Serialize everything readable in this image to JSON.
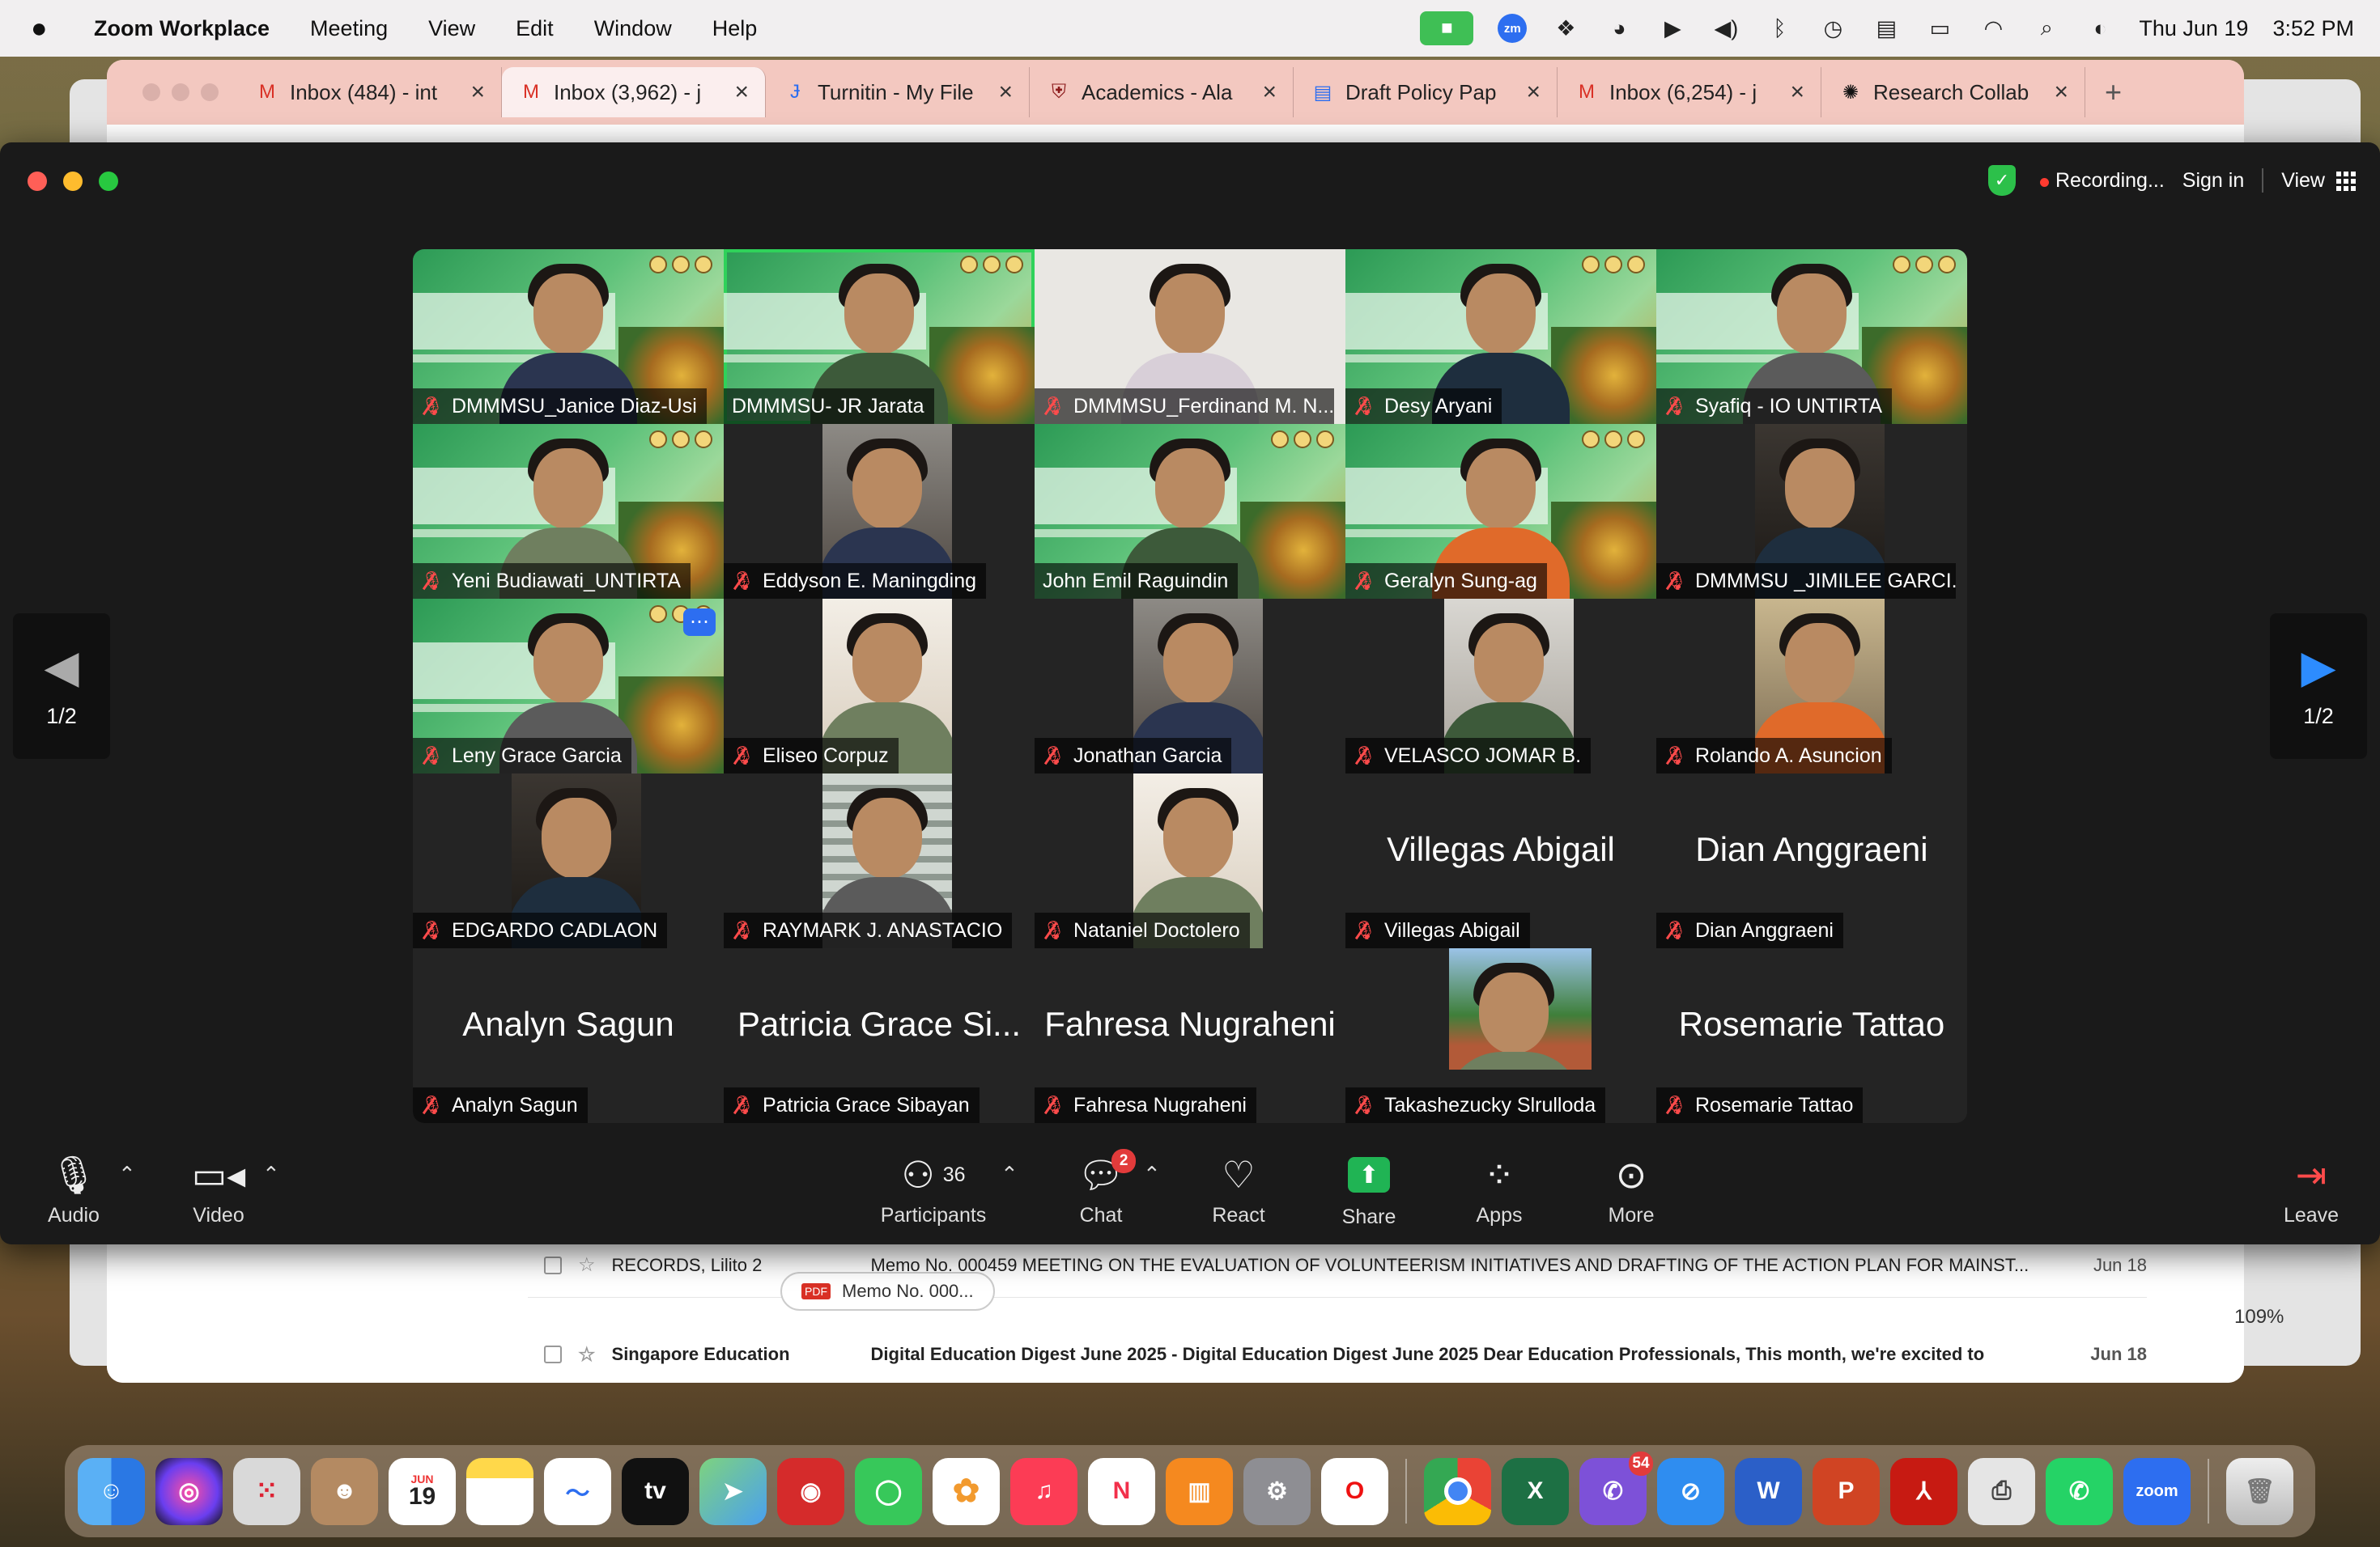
{
  "menubar": {
    "app_name": "Zoom Workplace",
    "menus": [
      "Meeting",
      "View",
      "Edit",
      "Window",
      "Help"
    ],
    "date": "Thu Jun 19",
    "time": "3:52 PM",
    "status_icons": [
      "zoom-video-icon",
      "zoom-badge-icon",
      "dropbox-icon",
      "creative-cloud-icon",
      "play-icon",
      "volume-icon",
      "bluetooth-icon",
      "time-machine-icon",
      "keyboard-icon",
      "battery-icon",
      "wifi-icon",
      "spotlight-icon",
      "control-center-icon"
    ]
  },
  "browser": {
    "tabs": [
      {
        "label": "Inbox (484) - int",
        "icon": "gmail-icon"
      },
      {
        "label": "Inbox (3,962) - j",
        "icon": "gmail-icon",
        "active": true
      },
      {
        "label": "Turnitin - My File",
        "icon": "turnitin-icon"
      },
      {
        "label": "Academics - Ala",
        "icon": "university-icon"
      },
      {
        "label": "Draft Policy Pap",
        "icon": "google-docs-icon"
      },
      {
        "label": "Inbox (6,254) - j",
        "icon": "gmail-icon"
      },
      {
        "label": "Research Collab",
        "icon": "openai-icon"
      }
    ],
    "new_tab": "+",
    "mail_rows": [
      {
        "sender": "RECORDS, Lilito 2",
        "subject": "Memo No. 000459 MEETING ON THE EVALUATION OF VOLUNTEERISM INITIATIVES AND DRAFTING OF THE ACTION PLAN FOR MAINST...",
        "date": "Jun 18"
      },
      {
        "sender": "Singapore Education",
        "subject": "Digital Education Digest June 2025 - Digital Education Digest June 2025 Dear Education Professionals, This month, we're excited to",
        "date": "Jun 18"
      }
    ],
    "attachment": "Memo No. 000...",
    "zoom_level": "109%"
  },
  "zoom": {
    "recording": "Recording...",
    "sign_in": "Sign in",
    "view": "View",
    "page_indicator": "1/2",
    "participants": [
      {
        "name": "DMMMSU_Janice Diaz-Usi",
        "video": "slide",
        "muted": true
      },
      {
        "name": "DMMMSU- JR Jarata",
        "video": "slide",
        "muted": false,
        "speaking": true
      },
      {
        "name": "DMMMSU_Ferdinand M. N...",
        "video": "white",
        "muted": true
      },
      {
        "name": "Desy Aryani",
        "video": "slide",
        "muted": true
      },
      {
        "name": "Syafiq - IO UNTIRTA",
        "video": "slide",
        "muted": true
      },
      {
        "name": "Yeni Budiawati_UNTIRTA",
        "video": "slide",
        "muted": true
      },
      {
        "name": "Eddyson E. Maningding",
        "video": "cam",
        "muted": true
      },
      {
        "name": "John Emil Raguindin",
        "video": "slide",
        "muted": false
      },
      {
        "name": "Geralyn Sung-ag",
        "video": "slide",
        "muted": true
      },
      {
        "name": "DMMMSU _JIMILEE GARCI...",
        "video": "cam",
        "muted": true
      },
      {
        "name": "Leny Grace Garcia",
        "video": "slide",
        "muted": true,
        "more": true
      },
      {
        "name": "Eliseo Corpuz",
        "video": "cam",
        "muted": true
      },
      {
        "name": "Jonathan Garcia",
        "video": "cam",
        "muted": true
      },
      {
        "name": "VELASCO JOMAR B.",
        "video": "cam",
        "muted": true
      },
      {
        "name": "Rolando A. Asuncion",
        "video": "cam",
        "muted": true
      },
      {
        "name": "EDGARDO CADLAON",
        "video": "cam",
        "muted": true
      },
      {
        "name": "RAYMARK J. ANASTACIO",
        "video": "cam",
        "muted": true
      },
      {
        "name": "Nataniel Doctolero",
        "video": "cam",
        "muted": true
      },
      {
        "name": "Villegas Abigail",
        "video": "none",
        "display": "Villegas Abigail",
        "muted": true
      },
      {
        "name": "Dian Anggraeni",
        "video": "none",
        "display": "Dian Anggraeni",
        "muted": true
      },
      {
        "name": "Analyn Sagun",
        "video": "none",
        "display": "Analyn Sagun",
        "muted": true
      },
      {
        "name": "Patricia Grace Sibayan",
        "video": "none",
        "display": "Patricia Grace Si...",
        "muted": true
      },
      {
        "name": "Fahresa Nugraheni",
        "video": "none",
        "display": "Fahresa Nugraheni",
        "muted": true
      },
      {
        "name": "Takashezucky Slrulloda",
        "video": "cam",
        "muted": true
      },
      {
        "name": "Rosemarie Tattao",
        "video": "none",
        "display": "Rosemarie Tattao",
        "muted": true
      }
    ],
    "toolbar": {
      "audio": "Audio",
      "video": "Video",
      "participants": "Participants",
      "participant_count": "36",
      "chat": "Chat",
      "chat_badge": "2",
      "react": "React",
      "share": "Share",
      "apps": "Apps",
      "more": "More",
      "leave": "Leave"
    }
  },
  "dock": {
    "calendar_month": "JUN",
    "calendar_day": "19",
    "viber_badge": "54",
    "apps": [
      "finder-icon",
      "siri-icon",
      "launchpad-icon",
      "contacts-icon",
      "calendar-icon",
      "notes-icon",
      "freeform-icon",
      "apple-tv-icon",
      "maps-icon",
      "photo-booth-icon",
      "messages-icon",
      "photos-icon",
      "music-icon",
      "news-icon",
      "books-icon",
      "system-settings-icon",
      "opera-icon",
      "chrome-icon",
      "excel-icon",
      "viber-icon",
      "safari-icon",
      "word-icon",
      "powerpoint-icon",
      "acrobat-icon",
      "printer-icon",
      "whatsapp-icon",
      "zoom-icon",
      "trash-icon"
    ],
    "zoom_label": "zoom"
  },
  "colors": {
    "speaking": "#2fd25a",
    "mute": "#ff4b4b",
    "share": "#20b454"
  }
}
